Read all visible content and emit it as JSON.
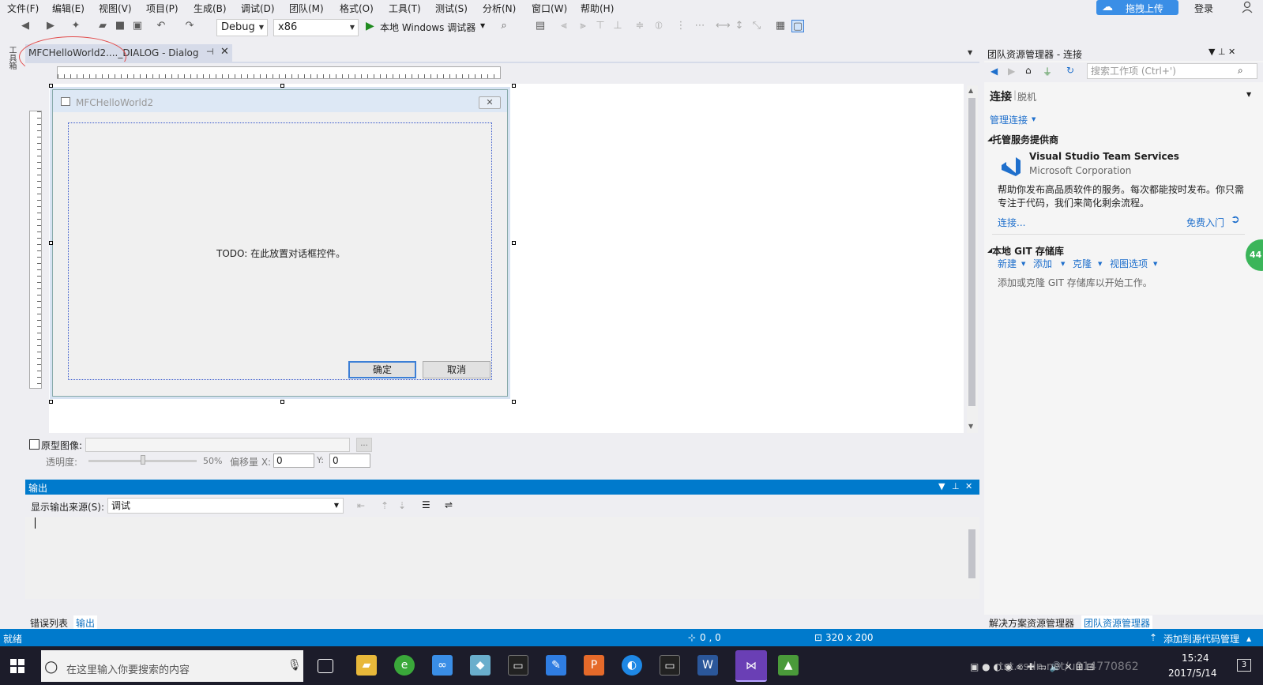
{
  "menu": {
    "items": [
      "文件(F)",
      "编辑(E)",
      "视图(V)",
      "项目(P)",
      "生成(B)",
      "调试(D)",
      "团队(M)",
      "格式(O)",
      "工具(T)",
      "测试(S)",
      "分析(N)",
      "窗口(W)",
      "帮助(H)"
    ],
    "upload_label": "拖拽上传",
    "login_label": "登录"
  },
  "toolbar": {
    "config": "Debug",
    "platform": "x86",
    "debugger_label": "本地 Windows 调试器"
  },
  "left_tab": {
    "label": "工具箱"
  },
  "document_tab": {
    "label": "MFCHelloWorld2...._DIALOG - Dialog"
  },
  "dialog": {
    "title": "MFCHelloWorld2",
    "todo_text": "TODO: 在此放置对话框控件。",
    "ok_label": "确定",
    "cancel_label": "取消"
  },
  "prototype": {
    "label": "原型图像:",
    "opacity_label": "透明度:",
    "opacity_value": "50%",
    "opacity_fraction": 0.5,
    "offset_label": "偏移量 X:",
    "x_value": "0",
    "y_label": "Y:",
    "y_value": "0",
    "browse": "..."
  },
  "output": {
    "title": "输出",
    "source_label": "显示输出来源(S):",
    "source_value": "调试"
  },
  "bottom_tabs": [
    "错误列表",
    "输出"
  ],
  "team_explorer": {
    "title": "团队资源管理器 - 连接",
    "search_placeholder": "搜索工作项 (Ctrl+')",
    "connect": "连接",
    "offline": "脱机",
    "manage": "管理连接",
    "hosted_header": "托管服务提供商",
    "vsts_name": "Visual Studio Team Services",
    "vsts_corp": "Microsoft Corporation",
    "vsts_desc": "帮助你发布高品质软件的服务。每次都能按时发布。你只需专注于代码，我们来简化剩余流程。",
    "connect_link": "连接...",
    "start_link": "免费入门",
    "git_header": "本地 GIT 存储库",
    "git_actions": [
      "新建",
      "添加",
      "克隆",
      "视图选项"
    ],
    "git_desc": "添加或克隆 GIT 存储库以开始工作。",
    "tabs": [
      "解决方案资源管理器",
      "团队资源管理器"
    ],
    "badge": "44"
  },
  "status": {
    "ready": "就绪",
    "position": "0 , 0",
    "size": "320 x 200",
    "source_control": "添加到源代码管理"
  },
  "taskbar": {
    "search_placeholder": "在这里输入你要搜索的内容",
    "time": "15:24",
    "date": "2017/5/14",
    "watermark": "tst.csdn.net/u014770862",
    "notify_count": "3"
  },
  "colors": {
    "accent": "#007acc",
    "dialog_title_bg": "#dde8f5",
    "taskbar": "#1c1c2a"
  }
}
